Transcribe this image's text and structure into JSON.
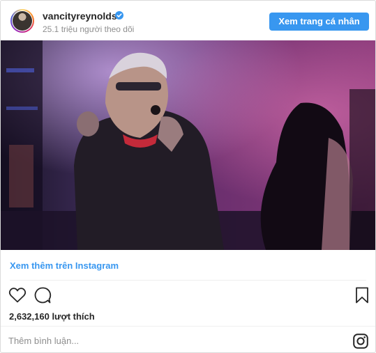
{
  "post": {
    "username": "vancityreynolds",
    "followers": "25.1 triệu người theo dõi",
    "profile_button": "Xem trang cá nhân",
    "view_more": "Xem thêm trên Instagram",
    "likes": "2,632,160 lượt thích",
    "comment_placeholder": "Thêm bình luận..."
  },
  "colors": {
    "accent": "#3897f0",
    "muted_text": "#8e8e8e",
    "primary_text": "#262626",
    "divider": "#efefef"
  },
  "icons": [
    "verified-badge-icon",
    "heart-icon",
    "comment-icon",
    "bookmark-icon",
    "instagram-logo-icon"
  ]
}
